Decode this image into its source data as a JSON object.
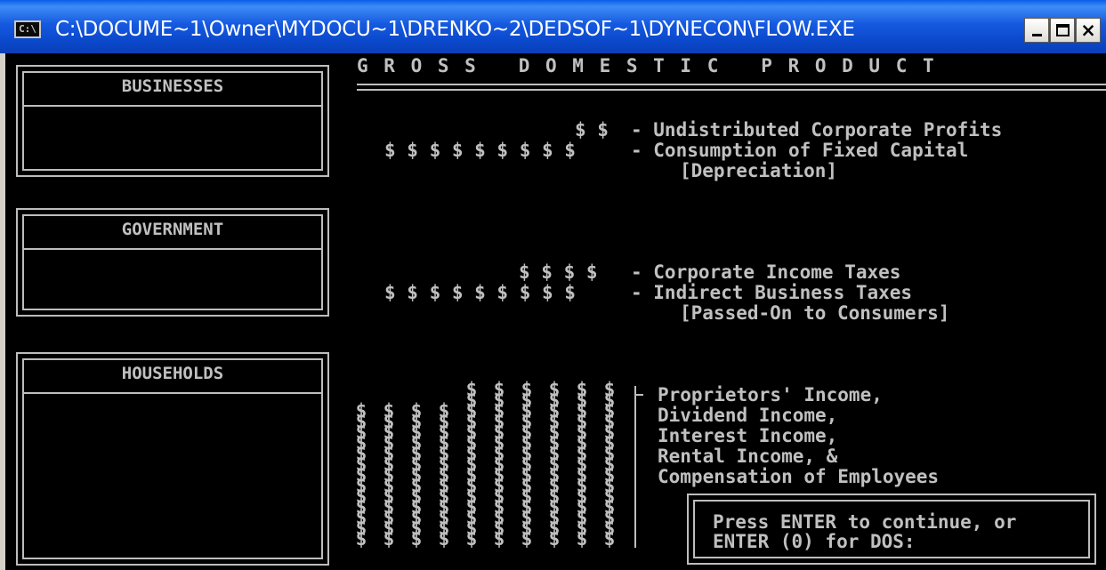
{
  "window": {
    "title": "C:\\DOCUME~1\\Owner\\MYDOCU~1\\DRENKO~2\\DEDSOF~1\\DYNECON\\FLOW.EXE",
    "icon_label": "C:\\",
    "buttons": {
      "minimize_icon": "minimize-icon",
      "maximize_icon": "maximize-icon",
      "close_label": "×"
    }
  },
  "header": {
    "title": "G R O S S   D O M E S T I C   P R O D U C T"
  },
  "sectors": {
    "businesses": "BUSINESSES",
    "government": "GOVERNMENT",
    "households": "HOUSEHOLDS"
  },
  "business_flows": {
    "line1_dollars": "$ $",
    "line1_label": "- Undistributed Corporate Profits",
    "line2_dollars": "$ $ $ $ $ $ $ $ $",
    "line2_label": "- Consumption of Fixed Capital",
    "line3_label": "[Depreciation]"
  },
  "government_flows": {
    "line1_dollars": "$ $ $ $",
    "line1_label": "- Corporate Income Taxes",
    "line2_dollars": "$ $ $ $ $ $ $ $ $",
    "line2_label": "- Indirect Business Taxes",
    "line3_label": "[Passed-On to Consumers]"
  },
  "household_flows": {
    "labels": [
      "Proprietors' Income,",
      "Dividend Income,",
      "Interest Income,",
      "Rental Income, &",
      "Compensation of Employees"
    ]
  },
  "prompt": {
    "line1": "Press ENTER to continue, or",
    "line2": "ENTER (0) for DOS:"
  },
  "colors": {
    "titlebar": "#0a47c9",
    "console_bg": "#000000",
    "console_fg": "#c0c0c0"
  }
}
